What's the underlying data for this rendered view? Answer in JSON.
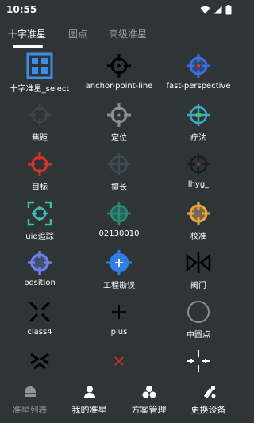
{
  "status_bar": {
    "time": "10:55"
  },
  "tabs": [
    {
      "label": "十字准星",
      "active": true
    },
    {
      "label": "圆点",
      "active": false
    },
    {
      "label": "高级准星",
      "active": false
    }
  ],
  "crosshairs": [
    {
      "label": "十字准星_select",
      "icon": "grid-select-icon",
      "color": "#3a8ee6"
    },
    {
      "label": "anchor-point-line",
      "icon": "anchor-crosshair-icon",
      "color": "#000000"
    },
    {
      "label": "fast-perspective",
      "icon": "perspective-crosshair-icon",
      "color": "#3a6fe0"
    },
    {
      "label": "焦距",
      "icon": "focus-crosshair-icon",
      "color": "#3f4547"
    },
    {
      "label": "定位",
      "icon": "locate-crosshair-icon",
      "color": "#8a8f92"
    },
    {
      "label": "疗法",
      "icon": "therapy-crosshair-icon",
      "color": "#3ea9c8"
    },
    {
      "label": "目标",
      "icon": "target-crosshair-icon",
      "color": "#d8322b"
    },
    {
      "label": "擅长",
      "icon": "expert-crosshair-icon",
      "color": "#3f4a52"
    },
    {
      "label": "lhyg_",
      "icon": "lhyg-crosshair-icon",
      "color": "#1a1d1f"
    },
    {
      "label": "uid追踪",
      "icon": "uid-track-icon",
      "color": "#3dbdb6"
    },
    {
      "label": "02130010",
      "icon": "teal-crosshair-icon",
      "color": "#2a8a7a"
    },
    {
      "label": "校准",
      "icon": "calibrate-crosshair-icon",
      "color": "#e8a642"
    },
    {
      "label": "position",
      "icon": "position-crosshair-icon",
      "color": "#6f7fe6"
    },
    {
      "label": "工程勘误",
      "icon": "engineering-crosshair-icon",
      "color": "#2f7fe6"
    },
    {
      "label": "阀门",
      "icon": "valve-icon",
      "color": "#000000"
    },
    {
      "label": "class4",
      "icon": "x-chevron-icon",
      "color": "#000000"
    },
    {
      "label": "plus",
      "icon": "plus-icon",
      "color": "#000000"
    },
    {
      "label": "中圆点",
      "icon": "circle-icon",
      "color": "#8a8f92"
    },
    {
      "label": "",
      "icon": "chevron-x-icon",
      "color": "#000000"
    },
    {
      "label": "",
      "icon": "small-x-icon",
      "color": "#b8302b"
    },
    {
      "label": "",
      "icon": "gap-cross-icon",
      "color": "#ffffff"
    }
  ],
  "bottom_nav": [
    {
      "label": "准星列表",
      "icon": "crosshair-list-icon",
      "active": true
    },
    {
      "label": "我的准星",
      "icon": "user-icon",
      "active": false
    },
    {
      "label": "方案管理",
      "icon": "scheme-icon",
      "active": false
    },
    {
      "label": "更换设备",
      "icon": "device-swap-icon",
      "active": false
    }
  ]
}
